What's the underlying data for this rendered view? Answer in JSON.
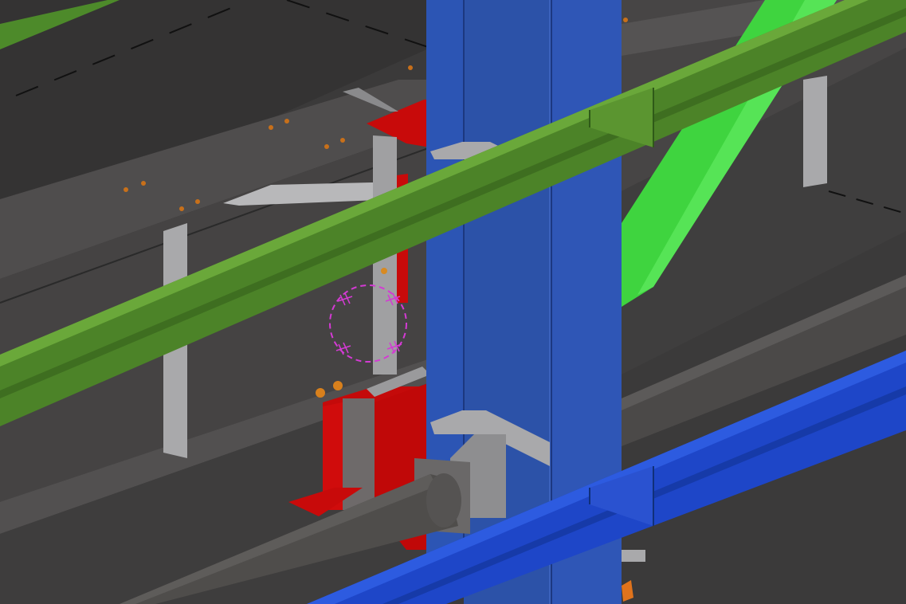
{
  "viewport": {
    "kind": "3d-structural-model-view",
    "colors": {
      "background": "#3a3a3a",
      "beam_web": "#4a4848",
      "beam_flange": "#5a5858",
      "green_beam": "#4e8a2a",
      "green_beam_light": "#6aa83a",
      "green_brace": "#3fd43f",
      "blue_column": "#2e54b4",
      "blue_column_dark": "#2a4aa0",
      "blue_beam": "#1e46c8",
      "red_plate": "#c80a0a",
      "grey_plate": "#a8a8aa",
      "pipe": "#4d4b49",
      "bolt": "#d87a1c",
      "selection_circle": "#d43ad4"
    },
    "icons": [
      "bolt-icon",
      "weld-symbol-icon",
      "pick-circle-icon"
    ]
  }
}
